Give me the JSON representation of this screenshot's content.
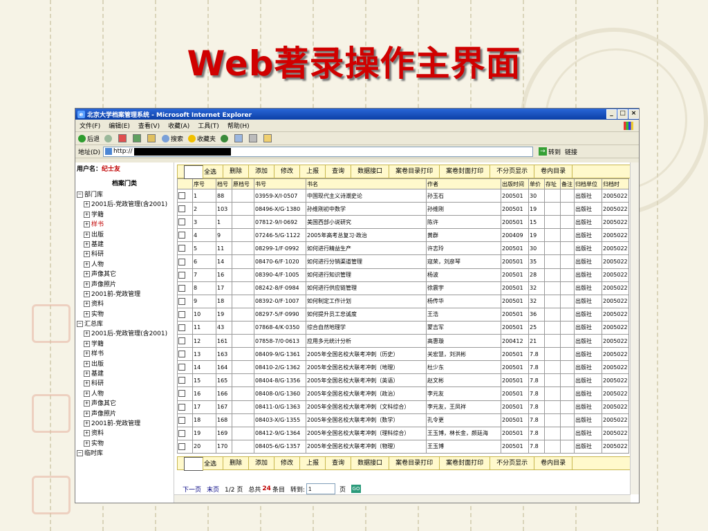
{
  "slide": {
    "title": "Web著录操作主界面"
  },
  "window": {
    "title": "北京大学档案管理系统 - Microsoft Internet Explorer",
    "controls": [
      "_",
      "□",
      "×"
    ],
    "menu": [
      "文件(F)",
      "编辑(E)",
      "查看(V)",
      "收藏(A)",
      "工具(T)",
      "帮助(H)"
    ],
    "toolbar": {
      "back": "后退",
      "search": "搜索",
      "favorites": "收藏夹"
    },
    "address": {
      "label": "地址(D)",
      "url": "http://",
      "go": "转到",
      "links": "链接"
    }
  },
  "sidebar": {
    "user_label": "用户名：",
    "user_name": "纪士友",
    "category_title": "档案门类",
    "groups": [
      {
        "name": "部门库",
        "items": [
          "2001后-党政管理(含2001)",
          "学籍",
          "样书",
          "出版",
          "基建",
          "科研",
          "人物",
          "声像其它",
          "声像照片",
          "2001前-党政管理",
          "资料",
          "实物"
        ]
      },
      {
        "name": "汇总库",
        "items": [
          "2001后-党政管理(含2001)",
          "学籍",
          "样书",
          "出版",
          "基建",
          "科研",
          "人物",
          "声像其它",
          "声像照片",
          "2001前-党政管理",
          "资料",
          "实物"
        ]
      },
      {
        "name": "临时库",
        "items": []
      }
    ],
    "selected_item": "样书"
  },
  "actions": [
    "全选",
    "删除",
    "添加",
    "修改",
    "上报",
    "查询",
    "数据接口",
    "案卷目录打印",
    "案卷封面打印",
    "不分页显示",
    "卷内目录"
  ],
  "table": {
    "columns": [
      "",
      "序号",
      "档号",
      "原档号",
      "书号",
      "书名",
      "作者",
      "出版时间",
      "单价",
      "存址",
      "备注",
      "归档单位",
      "归档时"
    ],
    "rows": [
      [
        "1",
        "88",
        "",
        "03959-X/I·0507",
        "中国现代主义诗潮史论",
        "孙玉石",
        "200501",
        "30",
        "",
        "",
        "出版社",
        "2005022"
      ],
      [
        "2",
        "103",
        "",
        "08496-X/G·1380",
        "孙维刚初中数学",
        "孙维刚",
        "200501",
        "19",
        "",
        "",
        "出版社",
        "2005022"
      ],
      [
        "3",
        "1",
        "",
        "07812-9/I·0692",
        "美国西部小说研究",
        "陈许",
        "200501",
        "15",
        "",
        "",
        "出版社",
        "2005022"
      ],
      [
        "4",
        "9",
        "",
        "07246-5/G·1122",
        "2005年高考总复习·政治",
        "黄群",
        "200409",
        "19",
        "",
        "",
        "出版社",
        "2005022"
      ],
      [
        "5",
        "11",
        "",
        "08299-1/F·0992",
        "如何进行精益生产",
        "许志玲",
        "200501",
        "30",
        "",
        "",
        "出版社",
        "2005022"
      ],
      [
        "6",
        "14",
        "",
        "08470-6/F·1020",
        "如何进行分销渠道管理",
        "寇荣，刘彦琴",
        "200501",
        "35",
        "",
        "",
        "出版社",
        "2005022"
      ],
      [
        "7",
        "16",
        "",
        "08390-4/F·1005",
        "如何进行知识管理",
        "杨波",
        "200501",
        "28",
        "",
        "",
        "出版社",
        "2005022"
      ],
      [
        "8",
        "17",
        "",
        "08242-8/F·0984",
        "如何进行供应链管理",
        "徐震宇",
        "200501",
        "32",
        "",
        "",
        "出版社",
        "2005022"
      ],
      [
        "9",
        "18",
        "",
        "08392-0/F·1007",
        "如何制定工作计划",
        "杨传华",
        "200501",
        "32",
        "",
        "",
        "出版社",
        "2005022"
      ],
      [
        "10",
        "19",
        "",
        "08297-5/F·0990",
        "如何提升员工忠诚度",
        "王浩",
        "200501",
        "36",
        "",
        "",
        "出版社",
        "2005022"
      ],
      [
        "11",
        "43",
        "",
        "07868-4/K·0350",
        "综合自然地理学",
        "蒙吉军",
        "200501",
        "25",
        "",
        "",
        "出版社",
        "2005022"
      ],
      [
        "12",
        "161",
        "",
        "07858-7/0·0613",
        "应用多元统计分析",
        "高惠璇",
        "200412",
        "21",
        "",
        "",
        "出版社",
        "2005022"
      ],
      [
        "13",
        "163",
        "",
        "08409-9/G·1361",
        "2005年全国名校大联考冲刺（历史）",
        "关宏慧，刘洪彬",
        "200501",
        "7.8",
        "",
        "",
        "出版社",
        "2005022"
      ],
      [
        "14",
        "164",
        "",
        "08410-2/G·1362",
        "2005年全国名校大联考冲刺（地理）",
        "杜少东",
        "200501",
        "7.8",
        "",
        "",
        "出版社",
        "2005022"
      ],
      [
        "15",
        "165",
        "",
        "08404-8/G·1356",
        "2005年全国名校大联考冲刺（英语）",
        "赵文彬",
        "200501",
        "7.8",
        "",
        "",
        "出版社",
        "2005022"
      ],
      [
        "16",
        "166",
        "",
        "08408-0/G·1360",
        "2005年全国名校大联考冲刺（政治）",
        "李元友",
        "200501",
        "7.8",
        "",
        "",
        "出版社",
        "2005022"
      ],
      [
        "17",
        "167",
        "",
        "08411-0/G·1363",
        "2005年全国名校大联考冲刺（文科综合）",
        "李元友，王凤祥",
        "200501",
        "7.8",
        "",
        "",
        "出版社",
        "2005022"
      ],
      [
        "18",
        "168",
        "",
        "08403-X/G·1355",
        "2005年全国名校大联考冲刺（数学）",
        "孔令更",
        "200501",
        "7.8",
        "",
        "",
        "出版社",
        "2005022"
      ],
      [
        "19",
        "169",
        "",
        "08412-9/G·1364",
        "2005年全国名校大联考冲刺（理科综合）",
        "王玉博，林长金，颜廷海",
        "200501",
        "7.8",
        "",
        "",
        "出版社",
        "2005022"
      ],
      [
        "20",
        "170",
        "",
        "08405-6/G·1357",
        "2005年全国名校大联考冲刺（物理）",
        "王玉博",
        "200501",
        "7.8",
        "",
        "",
        "出版社",
        "2005022"
      ]
    ]
  },
  "pager": {
    "next": "下一页",
    "last": "末页",
    "page": "1/2 页",
    "total_pre": "总共",
    "total": "24",
    "total_post": "条目",
    "jump": "转到:",
    "jump_value": "1",
    "jump_unit": "页",
    "go": "GO"
  },
  "colors": {
    "title": "#d00000",
    "titlebar": "#0b3fa6",
    "header_bg": "#fff9cc",
    "user_name": "#c00000"
  }
}
